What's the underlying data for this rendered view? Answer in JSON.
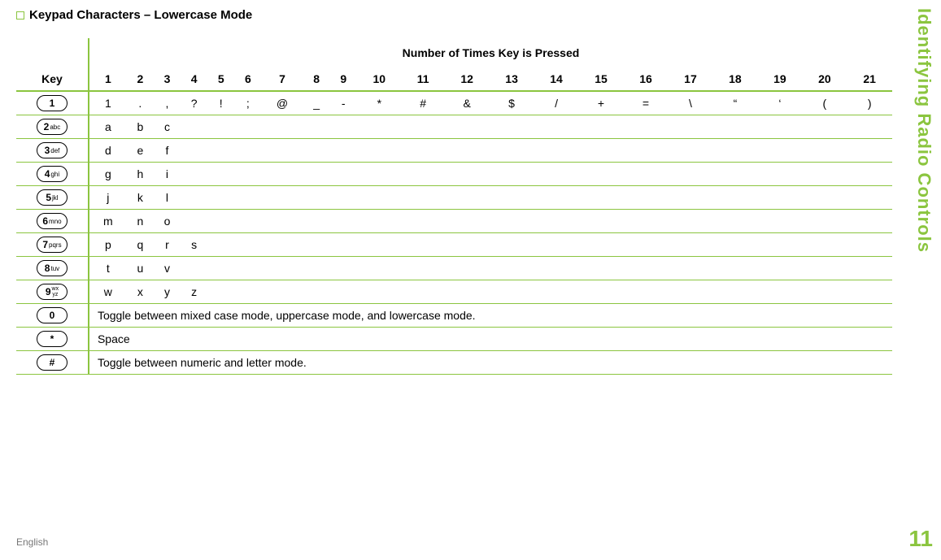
{
  "section_title": "Keypad Characters – Lowercase Mode",
  "header_span": "Number of Times Key is Pressed",
  "key_header": "Key",
  "cols": [
    "1",
    "2",
    "3",
    "4",
    "5",
    "6",
    "7",
    "8",
    "9",
    "10",
    "11",
    "12",
    "13",
    "14",
    "15",
    "16",
    "17",
    "18",
    "19",
    "20",
    "21"
  ],
  "rows": [
    {
      "key_num": "1",
      "key_sub": "",
      "cells": [
        "1",
        ".",
        ",",
        "?",
        "!",
        ";",
        "@",
        "_",
        "-",
        "*",
        "#",
        "&",
        "$",
        "/",
        "+",
        "=",
        "\\",
        "“",
        "‘",
        "(",
        ")"
      ]
    },
    {
      "key_num": "2",
      "key_sub": "abc",
      "cells": [
        "a",
        "b",
        "c",
        "",
        "",
        "",
        "",
        "",
        "",
        "",
        "",
        "",
        "",
        "",
        "",
        "",
        "",
        "",
        "",
        "",
        ""
      ]
    },
    {
      "key_num": "3",
      "key_sub": "def",
      "cells": [
        "d",
        "e",
        "f",
        "",
        "",
        "",
        "",
        "",
        "",
        "",
        "",
        "",
        "",
        "",
        "",
        "",
        "",
        "",
        "",
        "",
        ""
      ]
    },
    {
      "key_num": "4",
      "key_sub": "ghi",
      "cells": [
        "g",
        "h",
        "i",
        "",
        "",
        "",
        "",
        "",
        "",
        "",
        "",
        "",
        "",
        "",
        "",
        "",
        "",
        "",
        "",
        "",
        ""
      ]
    },
    {
      "key_num": "5",
      "key_sub": "jkl",
      "cells": [
        "j",
        "k",
        "l",
        "",
        "",
        "",
        "",
        "",
        "",
        "",
        "",
        "",
        "",
        "",
        "",
        "",
        "",
        "",
        "",
        "",
        ""
      ]
    },
    {
      "key_num": "6",
      "key_sub": "mno",
      "cells": [
        "m",
        "n",
        "o",
        "",
        "",
        "",
        "",
        "",
        "",
        "",
        "",
        "",
        "",
        "",
        "",
        "",
        "",
        "",
        "",
        "",
        ""
      ]
    },
    {
      "key_num": "7",
      "key_sub": "pqrs",
      "cells": [
        "p",
        "q",
        "r",
        "s",
        "",
        "",
        "",
        "",
        "",
        "",
        "",
        "",
        "",
        "",
        "",
        "",
        "",
        "",
        "",
        "",
        ""
      ]
    },
    {
      "key_num": "8",
      "key_sub": "tuv",
      "cells": [
        "t",
        "u",
        "v",
        "",
        "",
        "",
        "",
        "",
        "",
        "",
        "",
        "",
        "",
        "",
        "",
        "",
        "",
        "",
        "",
        "",
        ""
      ]
    },
    {
      "key_num": "9",
      "key_sub": "wxyz",
      "stack": true,
      "cells": [
        "w",
        "x",
        "y",
        "z",
        "",
        "",
        "",
        "",
        "",
        "",
        "",
        "",
        "",
        "",
        "",
        "",
        "",
        "",
        "",
        "",
        ""
      ]
    }
  ],
  "special_rows": [
    {
      "key_num": "0",
      "key_sub": "",
      "desc": "Toggle between mixed case mode, uppercase mode, and lowercase mode."
    },
    {
      "key_num": "*",
      "key_sub": "",
      "desc": "Space"
    },
    {
      "key_num": "#",
      "key_sub": "",
      "desc": "Toggle between numeric and letter mode."
    }
  ],
  "side_label": "Identifying Radio Controls",
  "page_number": "11",
  "english_label": "English"
}
